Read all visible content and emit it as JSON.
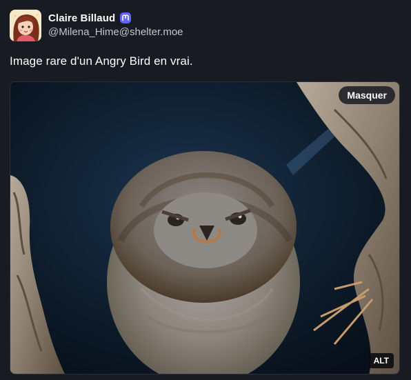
{
  "post": {
    "author": {
      "display_name": "Claire Billaud",
      "handle": "@Milena_Hime@shelter.moe",
      "badge_icon": "mastodon-icon"
    },
    "text": "Image rare d'un Angry Bird en vrai.",
    "media": {
      "hide_label": "Masquer",
      "alt_label": "ALT",
      "image_subject": "bird-photo"
    }
  },
  "colors": {
    "background": "#191b22",
    "text": "#ffffff",
    "muted": "#c3c5d1",
    "mastodon_badge": "#6364ff"
  }
}
